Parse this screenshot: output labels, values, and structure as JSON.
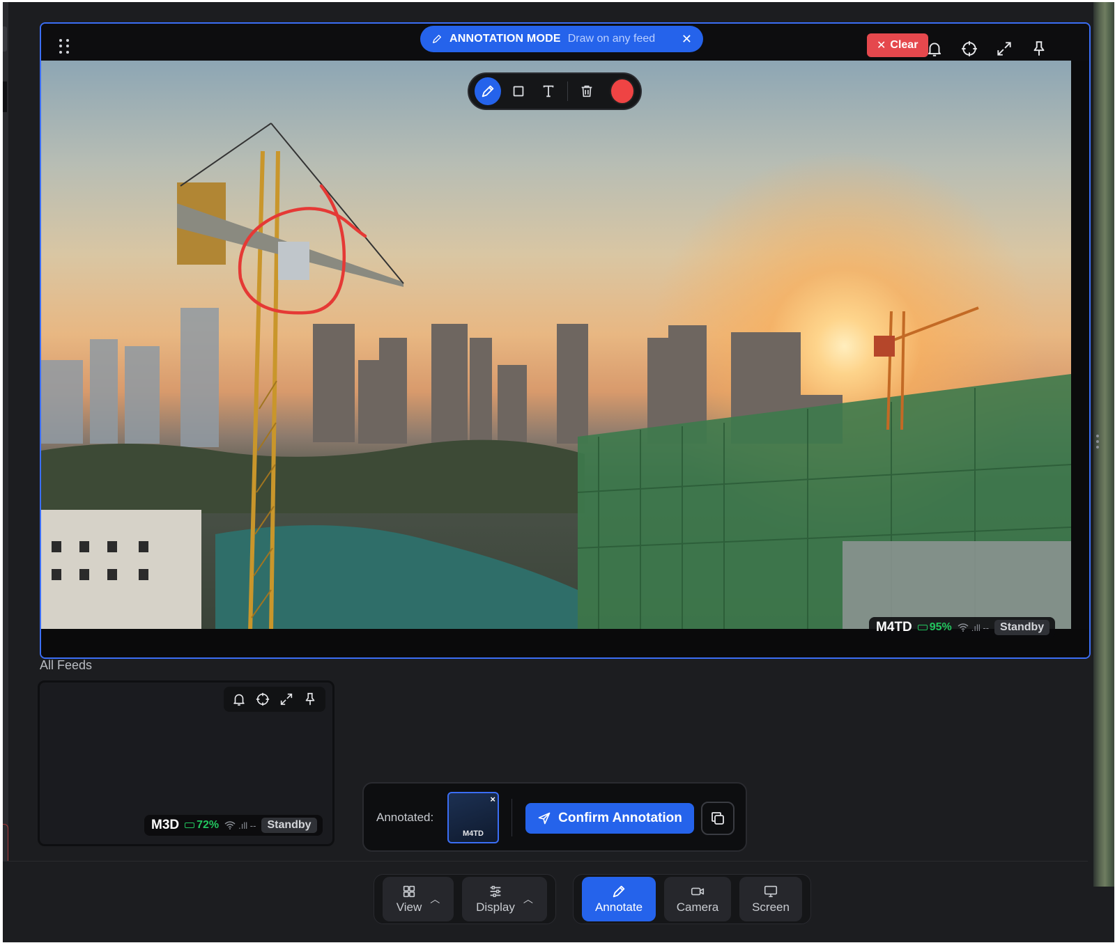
{
  "annotation_banner": {
    "mode": "ANNOTATION MODE",
    "hint": "Draw on any feed",
    "close_icon": "close-icon"
  },
  "main_feed": {
    "clear_label": "Clear",
    "controls": [
      "bell-icon",
      "crosshair-icon",
      "expand-icon",
      "pin-icon"
    ],
    "status": {
      "camera": "M4TD",
      "battery": "95%",
      "signal": ".ıll --",
      "state": "Standby"
    },
    "scene": "construction-cranes-sunset"
  },
  "draw_tools": {
    "tools": [
      "pen-icon",
      "rectangle-icon",
      "text-icon",
      "trash-icon"
    ],
    "active": "pen-icon",
    "color": "#ef4444"
  },
  "all_feeds": {
    "label": "All Feeds",
    "feeds": [
      {
        "camera": "M3D",
        "battery": "72%",
        "signal": ".ıll --",
        "state": "Standby",
        "controls": [
          "bell-icon",
          "crosshair-icon",
          "expand-icon",
          "pin-icon"
        ]
      }
    ]
  },
  "annotation_bar": {
    "label": "Annotated:",
    "thumb_tag": "M4TD",
    "thumb_close": "×",
    "confirm_label": "Confirm Annotation",
    "copy_icon": "copy-icon"
  },
  "dock": {
    "view_label": "View",
    "display_label": "Display",
    "annotate_label": "Annotate",
    "camera_label": "Camera",
    "screen_label": "Screen"
  },
  "colors": {
    "accent": "#2563eb",
    "danger": "#e5484d",
    "battery": "#22c55e",
    "background": "#1c1d20"
  }
}
